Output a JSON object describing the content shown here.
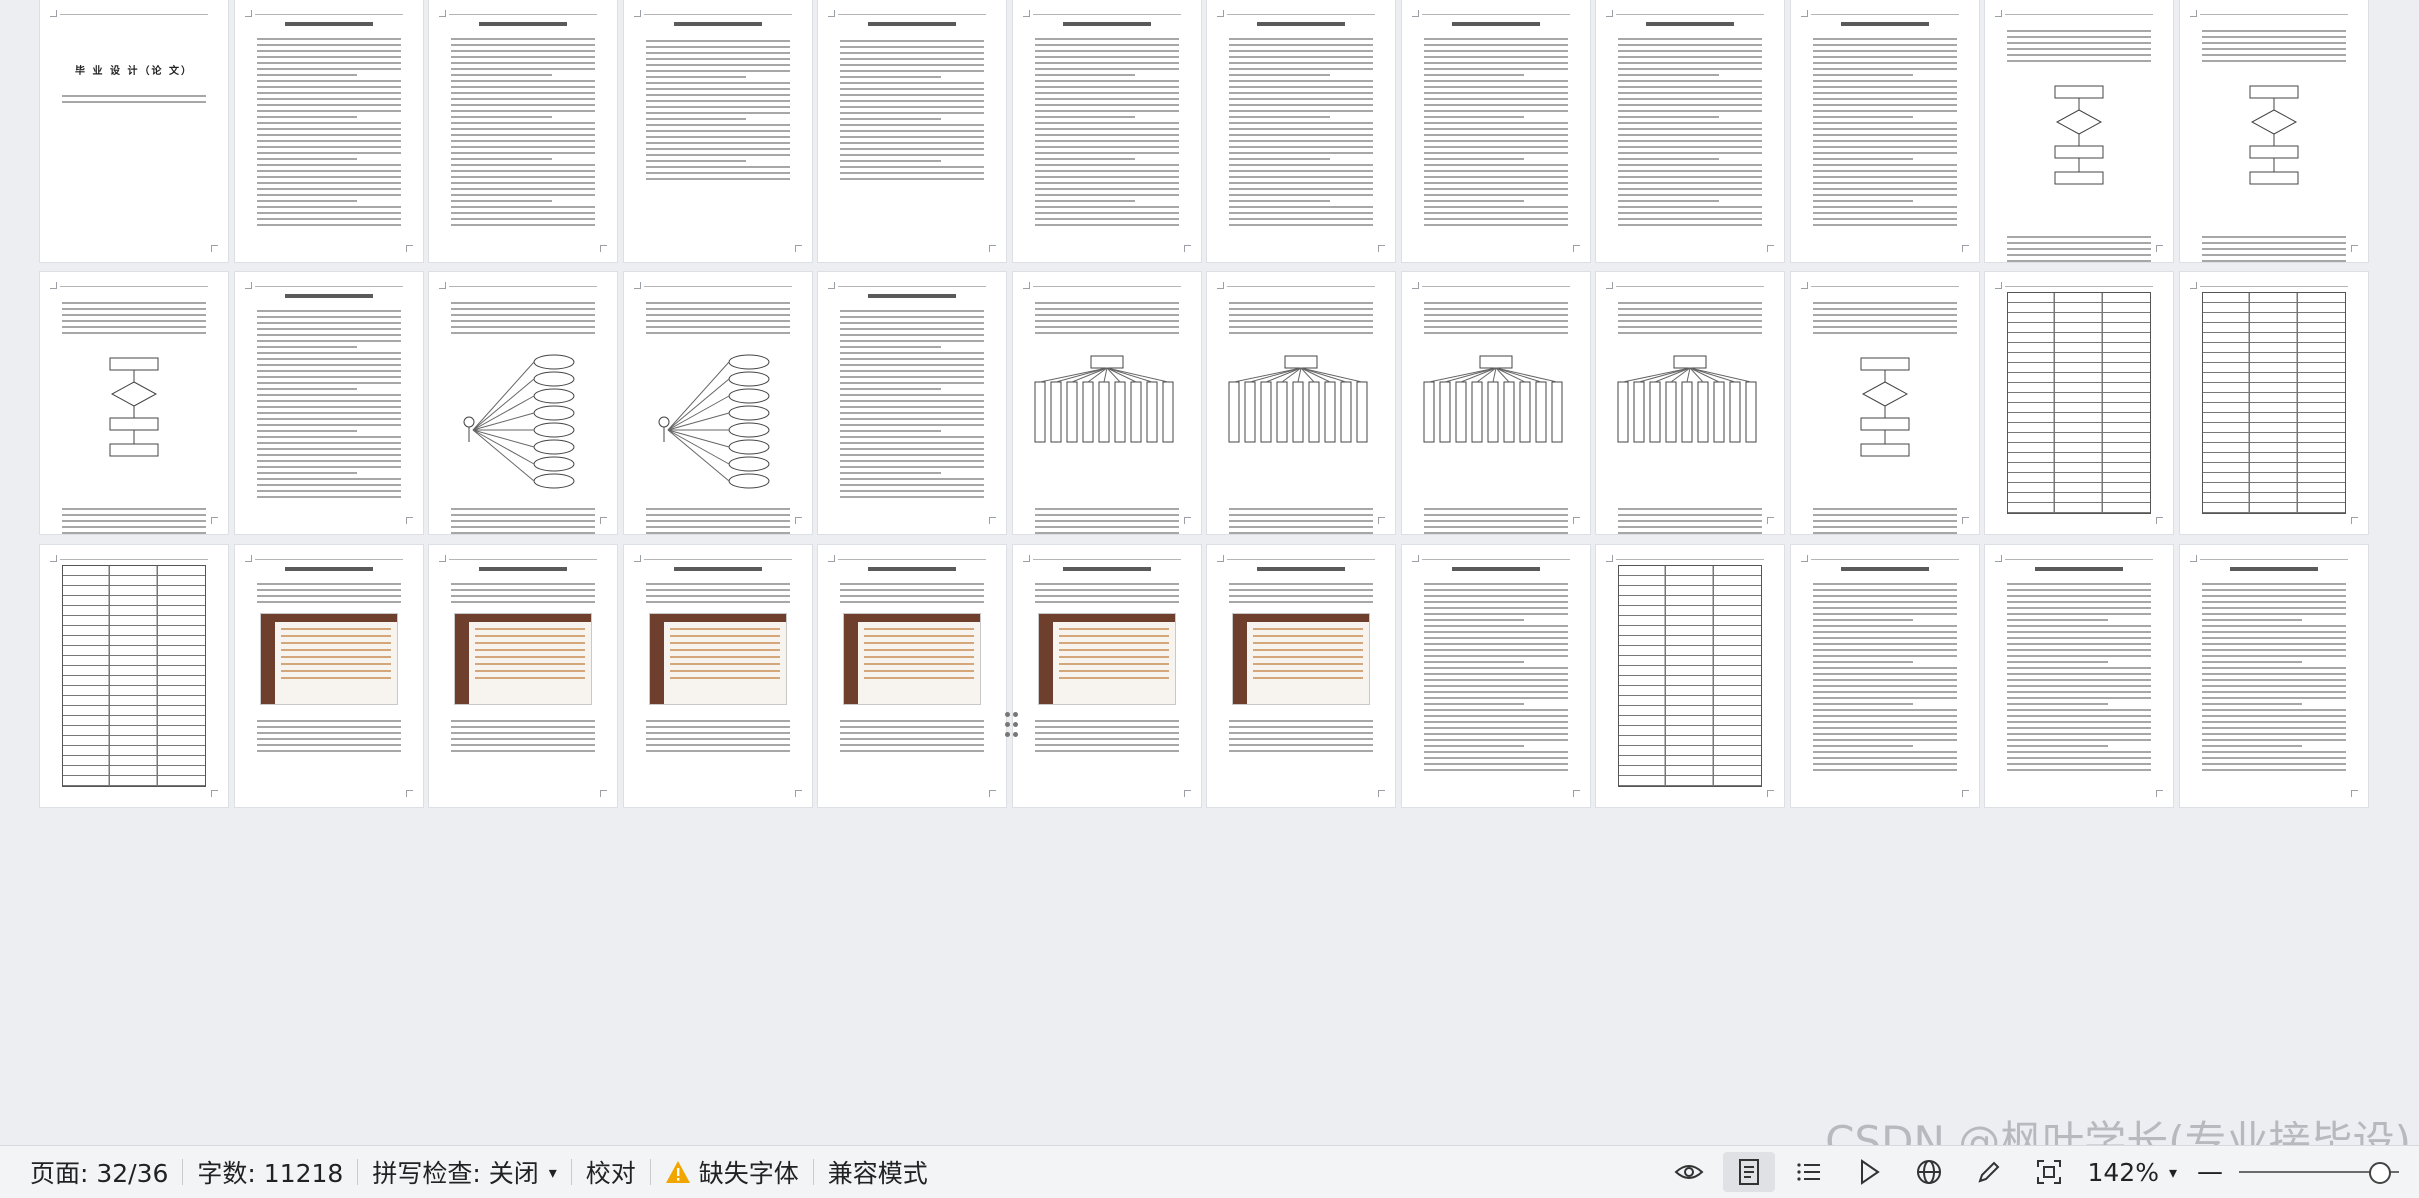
{
  "statusbar": {
    "page": "页面: 32/36",
    "words": "字数: 11218",
    "spellcheck": "拼写检查: 关闭",
    "proofread": "校对",
    "missing_fonts": "缺失字体",
    "compat_mode": "兼容模式",
    "zoom": "142%"
  },
  "document": {
    "cover_title": "毕 业 设 计（论 文）"
  },
  "watermark": "CSDN @枫叶学长(专业接毕设)",
  "icons": {
    "warning": "warning-icon",
    "eye": "eye-icon",
    "page_view": "page-view-icon",
    "outline": "outline-icon",
    "play": "play-icon",
    "web": "globe-icon",
    "pen": "pen-icon",
    "fit": "fit-page-icon"
  },
  "colors": {
    "accent_brown": "#6e3f2c",
    "warning": "#f0a500"
  }
}
